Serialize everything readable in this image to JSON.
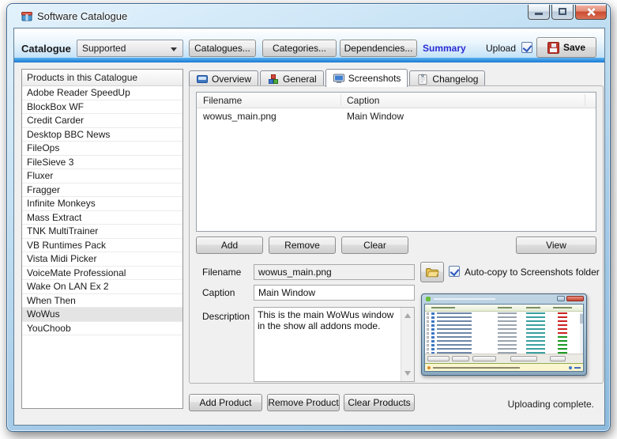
{
  "window": {
    "title": "Software Catalogue"
  },
  "toolbar": {
    "catalogue_label": "Catalogue",
    "catalogue_value": "Supported",
    "catalogues_button": "Catalogues...",
    "categories_button": "Categories...",
    "dependencies_button": "Dependencies...",
    "summary_link": "Summary",
    "upload_label": "Upload",
    "upload_checked": true,
    "save_button": "Save"
  },
  "products": {
    "header": "Products in this Catalogue",
    "selected": "WoWus",
    "items": [
      "Adobe Reader SpeedUp",
      "BlockBox WF",
      "Credit Carder",
      "Desktop BBC News",
      "FileOps",
      "FileSieve 3",
      "Fluxer",
      "Fragger",
      "Infinite Monkeys",
      "Mass Extract",
      "TNK MultiTrainer",
      "VB Runtimes Pack",
      "Vista Midi Picker",
      "VoiceMate Professional",
      "Wake On LAN Ex 2",
      "When Then",
      "WoWus",
      "YouChoob"
    ]
  },
  "tabs": {
    "overview": "Overview",
    "general": "General",
    "screenshots": "Screenshots",
    "changelog": "Changelog",
    "active": "Screenshots"
  },
  "screenshots": {
    "columns": {
      "filename": "Filename",
      "caption": "Caption"
    },
    "rows": [
      {
        "filename": "wowus_main.png",
        "caption": "Main Window"
      }
    ],
    "add_button": "Add",
    "remove_button": "Remove",
    "clear_button": "Clear",
    "view_button": "View",
    "form": {
      "filename_label": "Filename",
      "filename_value": "wowus_main.png",
      "autocopy_label": "Auto-copy to Screenshots folder",
      "autocopy_checked": true,
      "caption_label": "Caption",
      "caption_value": "Main Window",
      "description_label": "Description",
      "description_value": "This is the main WoWus window in the show all addons mode."
    }
  },
  "footer": {
    "add_product_button": "Add Product",
    "remove_product_button": "Remove Product",
    "clear_products_button": "Clear Products",
    "status": "Uploading complete."
  },
  "colors": {
    "accent_blue": "#1a7ad2",
    "link_blue": "#2b2bd5",
    "save_icon_red": "#c0372c",
    "selection_gray": "#e4e4e4"
  }
}
